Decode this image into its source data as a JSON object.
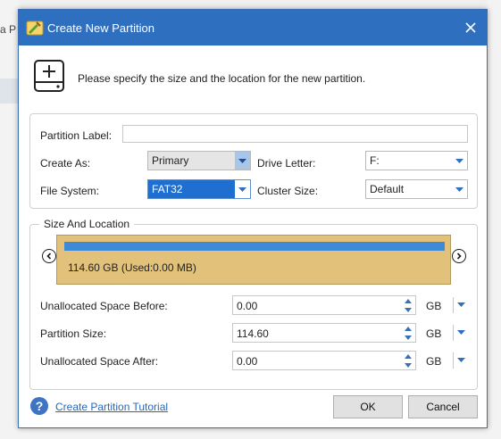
{
  "background": {
    "fragment_text": "a P"
  },
  "dialog": {
    "title": "Create New Partition",
    "close_icon": "close-icon",
    "description": "Please specify the size and the location for the new partition."
  },
  "form": {
    "partition_label": {
      "label": "Partition Label:",
      "value": ""
    },
    "create_as": {
      "label": "Create As:",
      "value": "Primary"
    },
    "drive_letter": {
      "label": "Drive Letter:",
      "value": "F:"
    },
    "file_system": {
      "label": "File System:",
      "value": "FAT32"
    },
    "cluster_size": {
      "label": "Cluster Size:",
      "value": "Default"
    }
  },
  "size_location": {
    "title": "Size And Location",
    "partition_text": "114.60 GB (Used:0.00 MB)",
    "unallocated_before": {
      "label": "Unallocated Space Before:",
      "value": "0.00",
      "unit": "GB"
    },
    "partition_size": {
      "label": "Partition Size:",
      "value": "114.60",
      "unit": "GB"
    },
    "unallocated_after": {
      "label": "Unallocated Space After:",
      "value": "0.00",
      "unit": "GB"
    }
  },
  "footer": {
    "tutorial_link": "Create Partition Tutorial",
    "ok_label": "OK",
    "cancel_label": "Cancel"
  },
  "colors": {
    "titlebar": "#2f6fbf",
    "partition_fill": "#e2c27a",
    "used_bar": "#3e8ad6",
    "selected_combo": "#1f6fd1",
    "link": "#2a67b5"
  }
}
